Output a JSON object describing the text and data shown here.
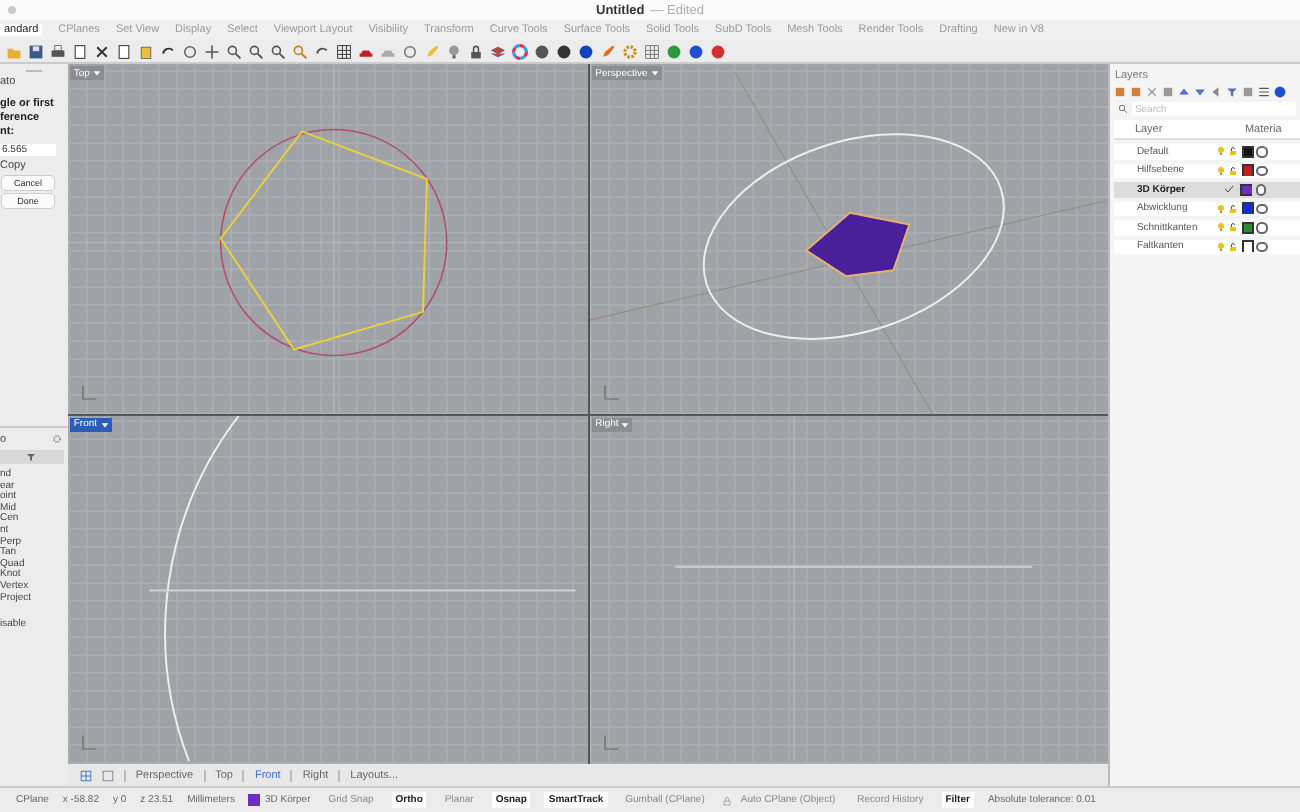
{
  "window": {
    "title": "Untitled",
    "subtitle": "— Edited"
  },
  "tabs": [
    {
      "label": "andard",
      "selected": true
    },
    {
      "label": "CPlanes",
      "selected": false
    },
    {
      "label": "Set View",
      "selected": false
    },
    {
      "label": "Display",
      "selected": false
    },
    {
      "label": "Select",
      "selected": false
    },
    {
      "label": "Viewport Layout",
      "selected": false
    },
    {
      "label": "Visibility",
      "selected": false
    },
    {
      "label": "Transform",
      "selected": false
    },
    {
      "label": "Curve Tools",
      "selected": false
    },
    {
      "label": "Surface Tools",
      "selected": false
    },
    {
      "label": "Solid Tools",
      "selected": false
    },
    {
      "label": "SubD Tools",
      "selected": false
    },
    {
      "label": "Mesh Tools",
      "selected": false
    },
    {
      "label": "Render Tools",
      "selected": false
    },
    {
      "label": "Drafting",
      "selected": false
    },
    {
      "label": "New in V8",
      "selected": false
    }
  ],
  "command_panel": {
    "option": "ato",
    "prompt_lines": [
      "gle or first",
      "ference",
      "nt:"
    ],
    "value": "6.565",
    "copy": "Copy",
    "buttons": [
      "Cancel",
      "Done"
    ]
  },
  "osnap_panel": {
    "title": "o",
    "items": [
      "nd",
      "ear",
      "oint",
      "Mid",
      "Cen",
      "nt",
      "Perp",
      "Tan",
      "Quad",
      "Knot",
      "Vertex",
      "Project"
    ],
    "disable": "isable"
  },
  "viewports": [
    {
      "label": "Top",
      "selected": false
    },
    {
      "label": "Perspective",
      "selected": false
    },
    {
      "label": "Front",
      "selected": true
    },
    {
      "label": "Right",
      "selected": false
    }
  ],
  "viewport_tabs": [
    {
      "label": "Perspective",
      "selected": false
    },
    {
      "label": "Top",
      "selected": false
    },
    {
      "label": "Front",
      "selected": true
    },
    {
      "label": "Right",
      "selected": false
    },
    {
      "label": "Layouts...",
      "selected": false
    }
  ],
  "layers": {
    "title": "Layers",
    "search_placeholder": "Search",
    "columns": [
      "Layer",
      "Materia"
    ],
    "rows": [
      {
        "name": "Default",
        "color": "#111111",
        "current": false
      },
      {
        "name": "Hilfsebene",
        "color": "#c0201c",
        "current": false
      },
      {
        "name": "3D Körper",
        "color": "#6a2fc0",
        "current": true
      },
      {
        "name": "Abwicklung",
        "color": "#1030e0",
        "current": false
      },
      {
        "name": "Schnittkanten",
        "color": "#2a8a2a",
        "current": false
      },
      {
        "name": "Faltkanten",
        "color": "#ffffff",
        "current": false
      }
    ]
  },
  "status_bar": {
    "cplane": "CPlane",
    "x": "x -58.82",
    "y": "y 0",
    "z": "z 23.51",
    "units": "Millimeters",
    "layer": {
      "name": "3D Körper",
      "color": "#6a2fc0"
    },
    "toggles": [
      {
        "label": "Grid Snap",
        "on": false,
        "kind": "plain"
      },
      {
        "label": "Ortho",
        "on": true,
        "kind": "plain"
      },
      {
        "label": "Planar",
        "on": false,
        "kind": "plain"
      },
      {
        "label": "Osnap",
        "on": true,
        "kind": "plain"
      },
      {
        "label": "SmartTrack",
        "on": true,
        "kind": "plain"
      },
      {
        "label": "Gumball (CPlane)",
        "on": false,
        "kind": "plain"
      },
      {
        "label": "Auto CPlane (Object)",
        "on": false,
        "kind": "lock"
      },
      {
        "label": "Record History",
        "on": false,
        "kind": "plain"
      },
      {
        "label": "Filter",
        "on": true,
        "kind": "plain"
      }
    ],
    "tolerance": "Absolute tolerance: 0.01"
  }
}
